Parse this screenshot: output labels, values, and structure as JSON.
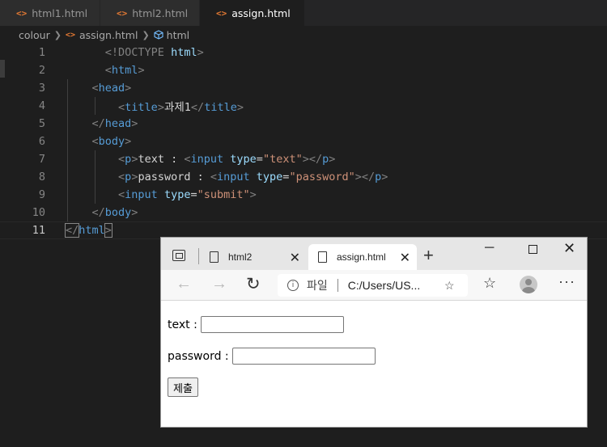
{
  "editor": {
    "tabs": [
      {
        "label": "html1.html",
        "icon": "html-file-icon"
      },
      {
        "label": "html2.html",
        "icon": "html-file-icon"
      },
      {
        "label": "assign.html",
        "icon": "html-file-icon",
        "active": true,
        "modified": true
      }
    ],
    "file_icon_glyph": "<>",
    "breadcrumb": [
      "colour",
      "assign.html",
      "html"
    ],
    "line_numbers": [
      "1",
      "2",
      "3",
      "4",
      "5",
      "6",
      "7",
      "8",
      "9",
      "10",
      "11"
    ],
    "code": {
      "l1": {
        "doctype": "<!DOCTYPE",
        "html": "html",
        "close": ">"
      },
      "l2": {
        "open": "<",
        "tag": "html",
        "close": ">"
      },
      "l3": {
        "open": "<",
        "tag": "head",
        "close": ">"
      },
      "l4": {
        "open": "<",
        "tag": "title",
        "close": ">",
        "text": "과제1",
        "eopen": "</",
        "etag": "title",
        "eclose": ">"
      },
      "l5": {
        "open": "</",
        "tag": "head",
        "close": ">"
      },
      "l6": {
        "open": "<",
        "tag": "body",
        "close": ">"
      },
      "l7": {
        "p_open": "<",
        "p": "p",
        "p_close": ">",
        "text": "text : ",
        "i_open": "<",
        "input": "input",
        "attr": "type",
        "eq": "=",
        "value": "\"text\"",
        "i_close": ">",
        "ep_open": "</",
        "ep": "p",
        "ep_close": ">"
      },
      "l8": {
        "p_open": "<",
        "p": "p",
        "p_close": ">",
        "text": "password : ",
        "i_open": "<",
        "input": "input",
        "attr": "type",
        "eq": "=",
        "value": "\"password\"",
        "i_close": ">",
        "ep_open": "</",
        "ep": "p",
        "ep_close": ">"
      },
      "l9": {
        "open": "<",
        "tag": "input",
        "attr": "type",
        "eq": "=",
        "value": "\"submit\"",
        "close": ">"
      },
      "l10": {
        "open": "</",
        "tag": "body",
        "close": ">"
      },
      "l11": {
        "open": "</",
        "tag": "html",
        "close": ">"
      }
    },
    "colors": {
      "background": "#1e1e1e",
      "tag": "#569cd6",
      "attribute": "#9cdcfe",
      "string": "#ce9178",
      "bracket": "#808080"
    }
  },
  "browser": {
    "tabs": [
      {
        "label": "html2"
      },
      {
        "label": "assign.html",
        "active": true
      }
    ],
    "new_tab_glyph": "+",
    "address": {
      "info_label": "파일",
      "url": "C:/Users/US..."
    },
    "page": {
      "text_label": "text :",
      "password_label": "password :",
      "submit_label": "제출"
    }
  }
}
